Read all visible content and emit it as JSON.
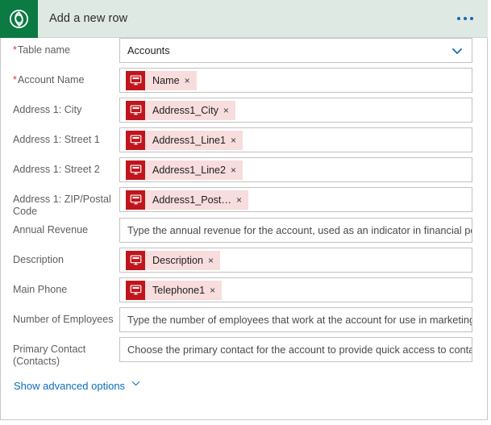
{
  "header": {
    "title": "Add a new row",
    "icon": "dataverse-logo-icon",
    "overflow_label": "...",
    "bg_color": "#dfe9e3",
    "icon_bg_color": "#0b7a43",
    "accent_color": "#1269b8"
  },
  "colors": {
    "token_icon_bg": "#c0151c",
    "token_bg": "#f7dddd",
    "required_star": "#d13438",
    "link": "#0f6cbd",
    "label": "#605e5c"
  },
  "fields": [
    {
      "label": "Table name",
      "required": true,
      "type": "dropdown",
      "value": "Accounts",
      "chevron": "chevron-down-icon"
    },
    {
      "label": "Account Name",
      "required": true,
      "type": "token",
      "token": "Name",
      "token_icon": "dynamic-content-monitor-icon",
      "remove_label": "×"
    },
    {
      "label": "Address 1: City",
      "required": false,
      "type": "token",
      "token": "Address1_City",
      "token_icon": "dynamic-content-monitor-icon",
      "remove_label": "×"
    },
    {
      "label": "Address 1: Street 1",
      "required": false,
      "type": "token",
      "token": "Address1_Line1",
      "token_icon": "dynamic-content-monitor-icon",
      "remove_label": "×"
    },
    {
      "label": "Address 1: Street 2",
      "required": false,
      "type": "token",
      "token": "Address1_Line2",
      "token_icon": "dynamic-content-monitor-icon",
      "remove_label": "×"
    },
    {
      "label": "Address 1: ZIP/Postal Code",
      "required": false,
      "type": "token",
      "token": "Address1_Post…",
      "token_icon": "dynamic-content-monitor-icon",
      "remove_label": "×"
    },
    {
      "label": "Annual Revenue",
      "required": false,
      "type": "text",
      "placeholder": "Type the annual revenue for the account, used as an indicator in financial performance"
    },
    {
      "label": "Description",
      "required": false,
      "type": "token",
      "token": "Description",
      "token_icon": "dynamic-content-monitor-icon",
      "remove_label": "×"
    },
    {
      "label": "Main Phone",
      "required": false,
      "type": "token",
      "token": "Telephone1",
      "token_icon": "dynamic-content-monitor-icon",
      "remove_label": "×"
    },
    {
      "label": "Number of Employees",
      "required": false,
      "type": "text",
      "placeholder": "Type the number of employees that work at the account for use in marketing segmentation"
    },
    {
      "label": "Primary Contact (Contacts)",
      "required": false,
      "type": "text",
      "placeholder": "Choose the primary contact for the account to provide quick access to contact details"
    }
  ],
  "footer": {
    "advanced_label": "Show advanced options",
    "advanced_icon": "chevron-down-icon"
  }
}
